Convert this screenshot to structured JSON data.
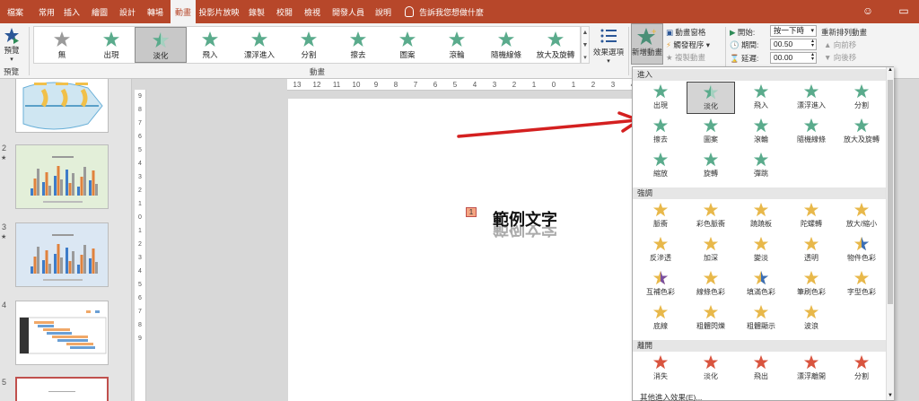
{
  "tabs": [
    "檔案",
    "常用",
    "插入",
    "繪圖",
    "設計",
    "轉場",
    "動畫",
    "投影片放映",
    "錄製",
    "校閱",
    "檢視",
    "開發人員",
    "說明"
  ],
  "active_tab": "動畫",
  "tell_me": "告訴我您想做什麼",
  "ribbon": {
    "preview_label": "預覽",
    "preview_group": "預覽",
    "animation_group": "動畫",
    "gallery": [
      "無",
      "出現",
      "淡化",
      "飛入",
      "漂浮進入",
      "分割",
      "擦去",
      "圖案",
      "滾輪",
      "隨機線條",
      "放大及旋轉"
    ],
    "gallery_selected": "淡化",
    "effect_options": "效果選項",
    "add_animation": "新增動畫",
    "animation_pane": "動畫窗格",
    "trigger": "觸發程序",
    "animation_painter": "複製動畫",
    "start_label": "開始:",
    "start_value": "按一下時",
    "duration_label": "期間:",
    "duration_value": "00.50",
    "delay_label": "延遲:",
    "delay_value": "00.00",
    "reorder_title": "重新排列動畫",
    "move_earlier": "向前移",
    "move_later": "向後移"
  },
  "hruler": [
    "13",
    "12",
    "11",
    "10",
    "9",
    "8",
    "7",
    "6",
    "5",
    "4",
    "3",
    "2",
    "1",
    "0",
    "1",
    "2",
    "3",
    "4"
  ],
  "vruler": [
    "9",
    "8",
    "7",
    "6",
    "5",
    "4",
    "3",
    "2",
    "1",
    "0",
    "1",
    "2",
    "3",
    "4",
    "5",
    "6",
    "7",
    "8",
    "9"
  ],
  "slides": [
    {
      "num": "",
      "star": ""
    },
    {
      "num": "2",
      "star": "★"
    },
    {
      "num": "3",
      "star": "★"
    },
    {
      "num": "4",
      "star": ""
    },
    {
      "num": "5",
      "star": ""
    }
  ],
  "canvas": {
    "anim_tag": "1",
    "sample_text": "範例文字"
  },
  "dropdown": {
    "sections": [
      {
        "name": "進入",
        "items": [
          "出現",
          "淡化",
          "飛入",
          "漂浮進入",
          "分割",
          "擦去",
          "圖案",
          "滾輪",
          "隨機線條",
          "放大及旋轉",
          "縮放",
          "旋轉",
          "彈跳"
        ]
      },
      {
        "name": "強調",
        "items": [
          "脈衝",
          "彩色脈衝",
          "蹺蹺板",
          "陀螺轉",
          "放大/縮小",
          "反滲透",
          "加深",
          "變淡",
          "透明",
          "物件色彩",
          "互補色彩",
          "線條色彩",
          "填滿色彩",
          "筆刷色彩",
          "字型色彩",
          "底線",
          "粗體閃爍",
          "粗體顯示",
          "波浪"
        ]
      },
      {
        "name": "離開",
        "items": [
          "消失",
          "淡化",
          "飛出",
          "漂浮離開",
          "分割"
        ]
      }
    ],
    "footer": "其他進入效果(E)..."
  },
  "colors": {
    "accent": "#b7472a",
    "entrance": "#5aab8c",
    "emphasis": "#e8b84a",
    "exit": "#d9543f",
    "arrow": "#d42020"
  }
}
